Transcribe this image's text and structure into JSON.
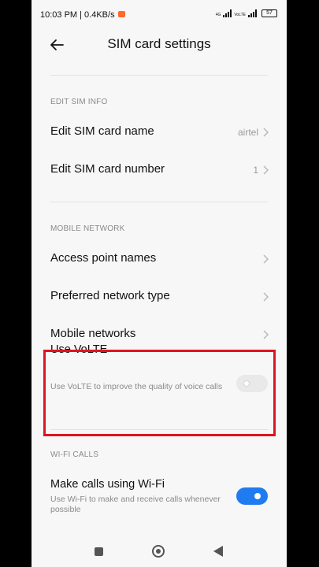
{
  "status_bar": {
    "time_speed": "10:03 PM | 0.4KB/s",
    "network_labels": [
      "4G",
      "VoLTE"
    ],
    "battery": "57"
  },
  "header": {
    "title": "SIM card settings"
  },
  "sections": {
    "edit_sim_info": {
      "header": "EDIT SIM INFO",
      "items": [
        {
          "label": "Edit SIM card name",
          "value": "airtel"
        },
        {
          "label": "Edit SIM card number",
          "value": "1"
        }
      ]
    },
    "mobile_network": {
      "header": "MOBILE NETWORK",
      "items": [
        {
          "label": "Access point names"
        },
        {
          "label": "Preferred network type"
        },
        {
          "label": "Mobile networks"
        }
      ],
      "volte": {
        "label": "Use VoLTE",
        "description": "Use VoLTE to improve the quality of voice calls",
        "enabled": false
      }
    },
    "wifi_calls": {
      "header": "WI-FI CALLS",
      "wifi_calling": {
        "label": "Make calls using Wi-Fi",
        "description": "Use Wi-Fi to make and receive calls whenever possible",
        "enabled": true
      }
    }
  },
  "colors": {
    "accent": "#1f7cf0",
    "highlight_border": "#e0141e"
  },
  "nav_icons": [
    "recents-icon",
    "home-icon",
    "back-icon"
  ]
}
